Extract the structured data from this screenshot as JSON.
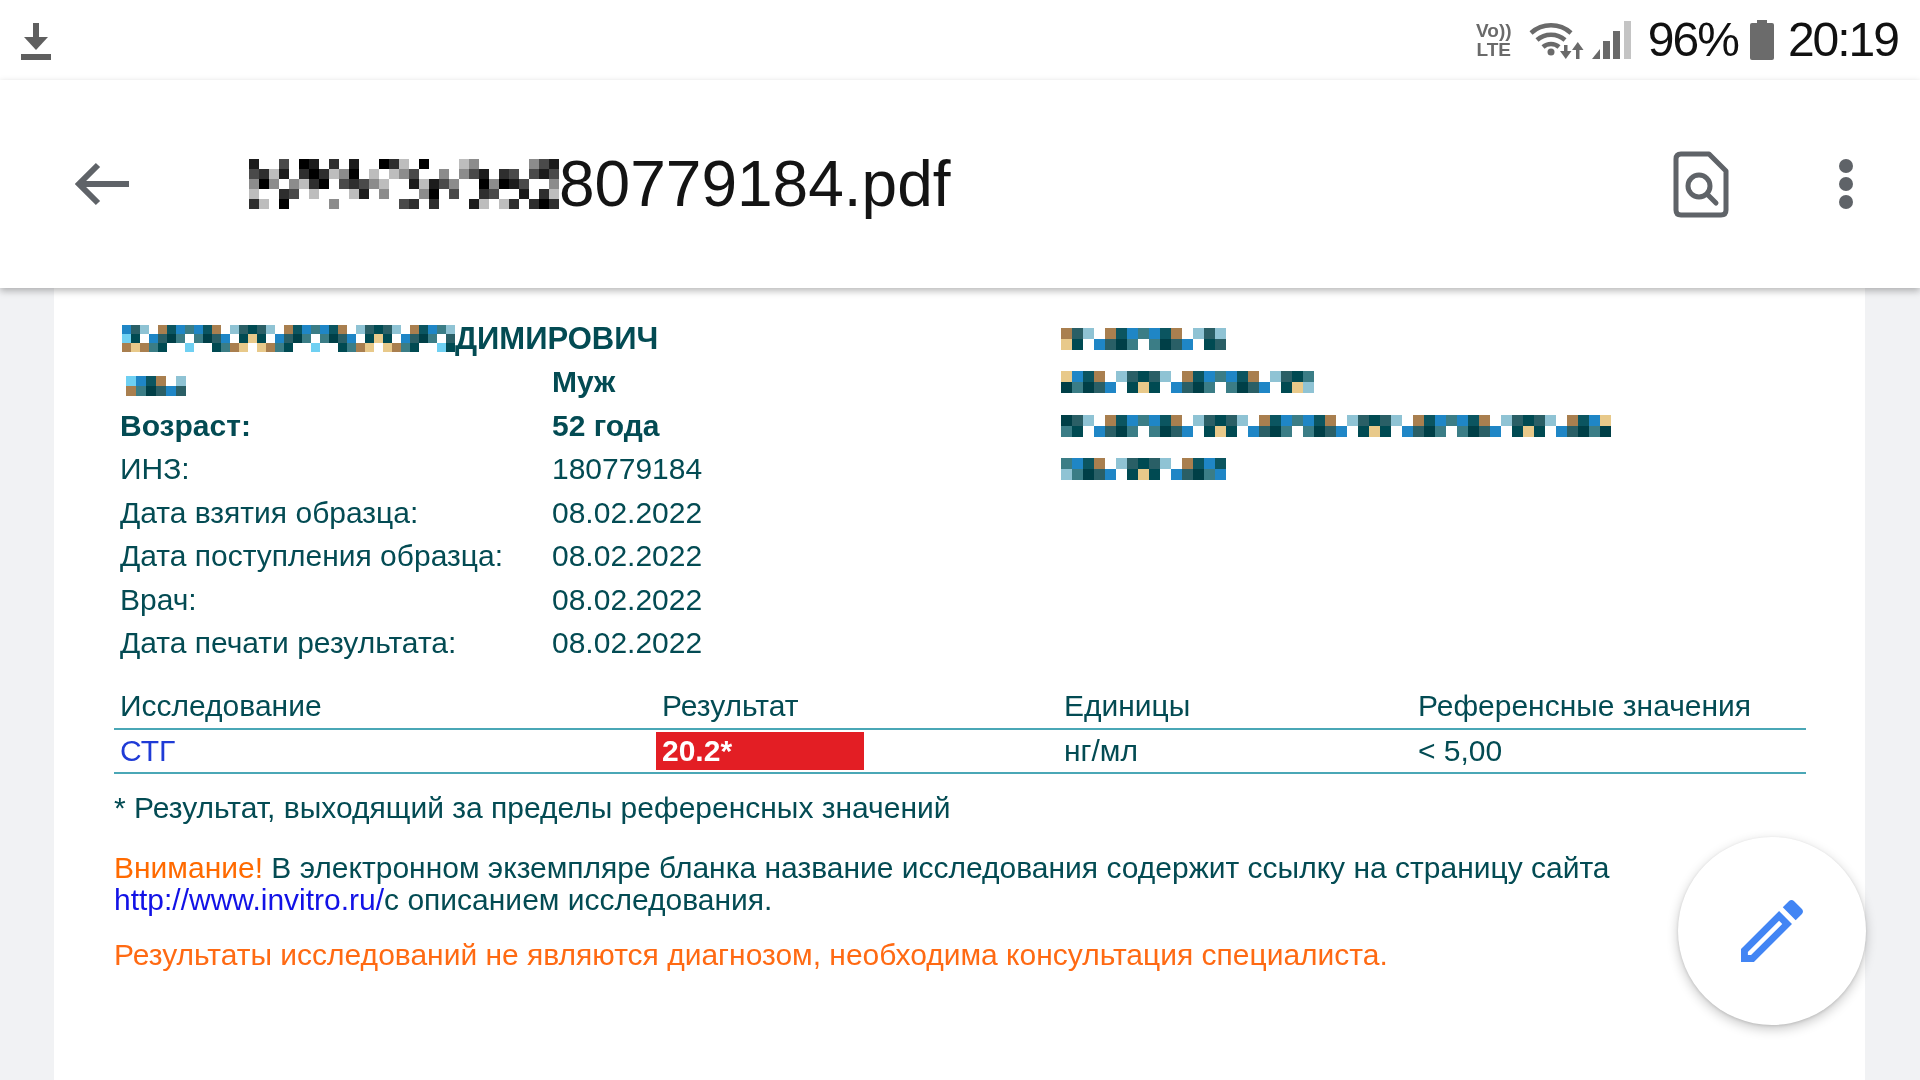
{
  "status_bar": {
    "volte": [
      "Vo))",
      "LTE"
    ],
    "battery": "96%",
    "time": "20:19"
  },
  "app_bar": {
    "title": "80779184.pdf"
  },
  "patient": {
    "name": "ДИМИРОВИЧ",
    "fields": [
      {
        "value": "Муж",
        "bold": true
      },
      {
        "label": "Возраст:",
        "value": "52 года",
        "bold": true
      },
      {
        "label": "ИНЗ:",
        "value": "180779184",
        "bold": false
      },
      {
        "label": "Дата взятия образца:",
        "value": "08.02.2022",
        "bold": false
      },
      {
        "label": "Дата поступления образца:",
        "value": "08.02.2022",
        "bold": false
      },
      {
        "label": "Врач:",
        "value": "08.02.2022",
        "bold": false
      },
      {
        "label": "Дата печати результата:",
        "value": "08.02.2022",
        "bold": false
      }
    ]
  },
  "results_table": {
    "columns": [
      "Исследование",
      "Результат",
      "Единицы",
      "Референсные значения"
    ],
    "rows": [
      {
        "test": "СТГ",
        "result": "20.2*",
        "units": "нг/мл",
        "reference": "< 5,00",
        "out_of_range": true
      }
    ]
  },
  "footnote": "* Результат, выходящий за пределы референсных значений",
  "notice": {
    "warning": "Внимание!",
    "text": "В электронном экземпляре бланка название исследования содержит ссылку на страницу сайта",
    "link": "http://www.invitro.ru/",
    "text_after": "с описанием исследования."
  },
  "disclaimer": "Результаты исследований не являются диагнозом, необходима консультация специалиста."
}
